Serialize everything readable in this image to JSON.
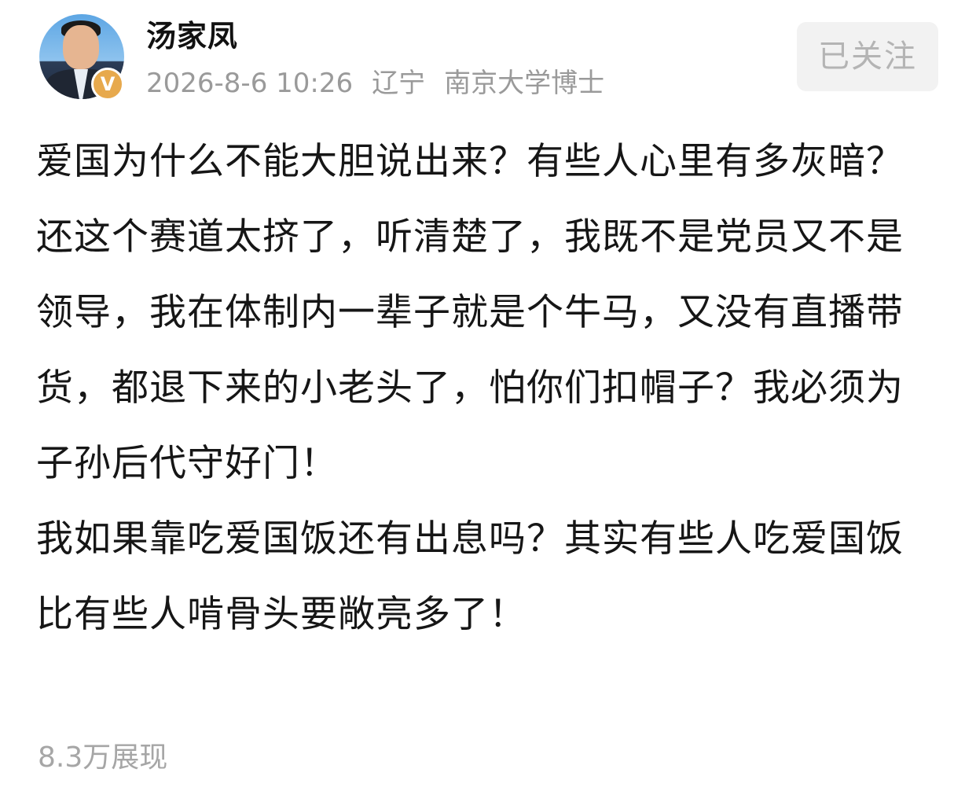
{
  "author": {
    "name": "汤家凤",
    "verified_label": "V",
    "avatar_icon": "user-avatar-photo"
  },
  "meta": {
    "date": "2026-8-6 10:26",
    "location": "辽宁",
    "title": "南京大学博士"
  },
  "follow_button": {
    "label": "已关注"
  },
  "post": {
    "paragraphs": [
      "爱国为什么不能大胆说出来？有些人心里有多灰暗？",
      "还这个赛道太挤了，听清楚了，我既不是党员又不是领导，我在体制内一辈子就是个牛马，又没有直播带货，都退下来的小老头了，怕你们扣帽子？我必须为子孙后代守好门！",
      "我如果靠吃爱国饭还有出息吗？其实有些人吃爱国饭比有些人啃骨头要敞亮多了！"
    ]
  },
  "stats": {
    "views": "8.3万展现"
  },
  "colors": {
    "text": "#161616",
    "meta": "#9a9a9a",
    "follow_bg": "#f2f2f2",
    "badge": "#e7a94d"
  }
}
